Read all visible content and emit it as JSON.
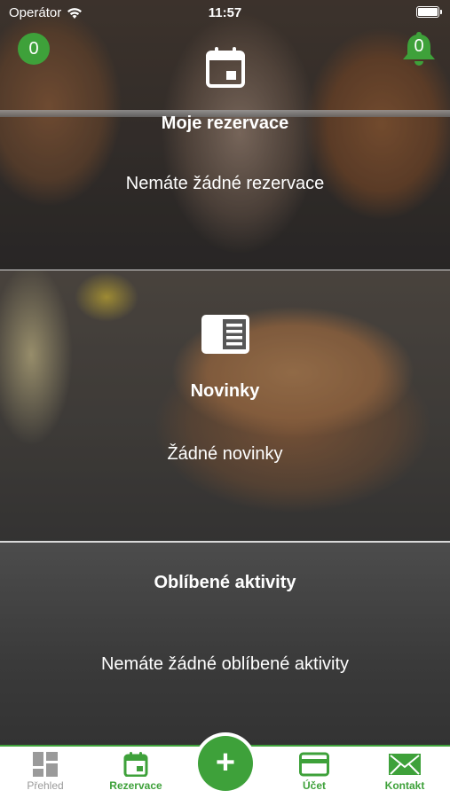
{
  "status_bar": {
    "carrier": "Operátor",
    "time": "11:57"
  },
  "badges": {
    "left_count": "0",
    "notifications_count": "0"
  },
  "reservations": {
    "title": "Moje rezervace",
    "message": "Nemáte žádné rezervace",
    "icon": "calendar-icon"
  },
  "news": {
    "title": "Novinky",
    "message": "Žádné novinky",
    "icon": "newspaper-icon"
  },
  "activities": {
    "title": "Oblíbené aktivity",
    "message": "Nemáte žádné oblíbené aktivity"
  },
  "tab_bar": {
    "overview": "Přehled",
    "reservations": "Rezervace",
    "add": "+",
    "account": "Účet",
    "contact": "Kontakt"
  },
  "colors": {
    "accent": "#3ea13a",
    "inactive": "#9a9a9a"
  }
}
